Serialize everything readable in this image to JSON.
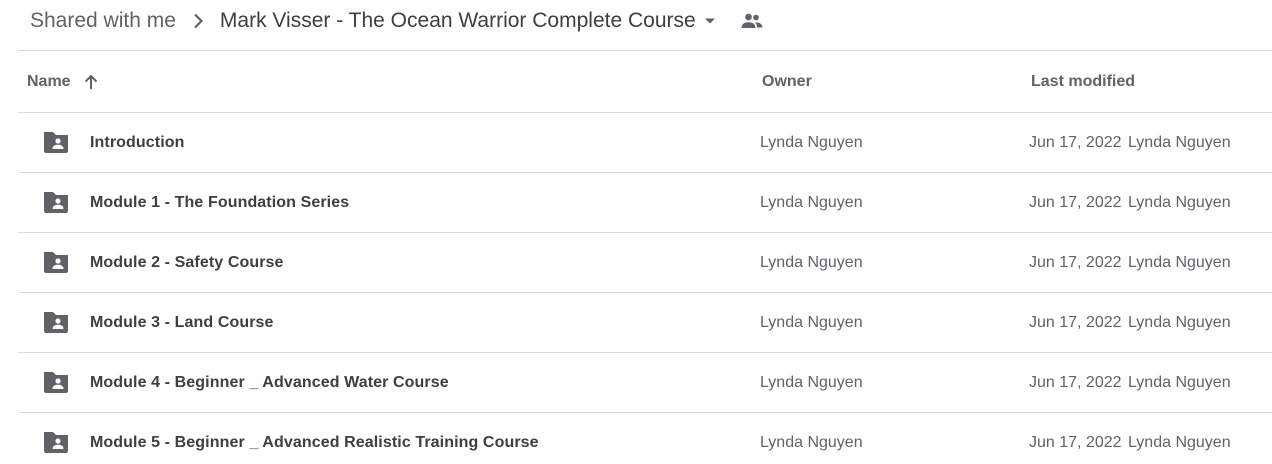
{
  "breadcrumb": {
    "root": "Shared with me",
    "current": "Mark Visser - The Ocean Warrior Complete Course"
  },
  "columns": {
    "name": "Name",
    "owner": "Owner",
    "last_modified": "Last modified"
  },
  "sort": {
    "column": "Name",
    "direction": "ascending"
  },
  "rows": [
    {
      "name": "Introduction",
      "owner": "Lynda Nguyen",
      "date": "Jun 17, 2022",
      "modified_by": "Lynda Nguyen",
      "icon": "shared-folder-icon"
    },
    {
      "name": "Module 1 - The Foundation Series",
      "owner": "Lynda Nguyen",
      "date": "Jun 17, 2022",
      "modified_by": "Lynda Nguyen",
      "icon": "shared-folder-icon"
    },
    {
      "name": "Module 2 - Safety Course",
      "owner": "Lynda Nguyen",
      "date": "Jun 17, 2022",
      "modified_by": "Lynda Nguyen",
      "icon": "shared-folder-icon"
    },
    {
      "name": "Module 3 - Land Course",
      "owner": "Lynda Nguyen",
      "date": "Jun 17, 2022",
      "modified_by": "Lynda Nguyen",
      "icon": "shared-folder-icon"
    },
    {
      "name": "Module 4 - Beginner _ Advanced Water Course",
      "owner": "Lynda Nguyen",
      "date": "Jun 17, 2022",
      "modified_by": "Lynda Nguyen",
      "icon": "shared-folder-icon"
    },
    {
      "name": "Module 5 - Beginner _ Advanced Realistic Training Course",
      "owner": "Lynda Nguyen",
      "date": "Jun 17, 2022",
      "modified_by": "Lynda Nguyen",
      "icon": "shared-folder-icon"
    }
  ],
  "colors": {
    "text_primary": "#3c4043",
    "text_secondary": "#5f6368",
    "divider": "#dadce0",
    "icon": "#5f6368"
  }
}
